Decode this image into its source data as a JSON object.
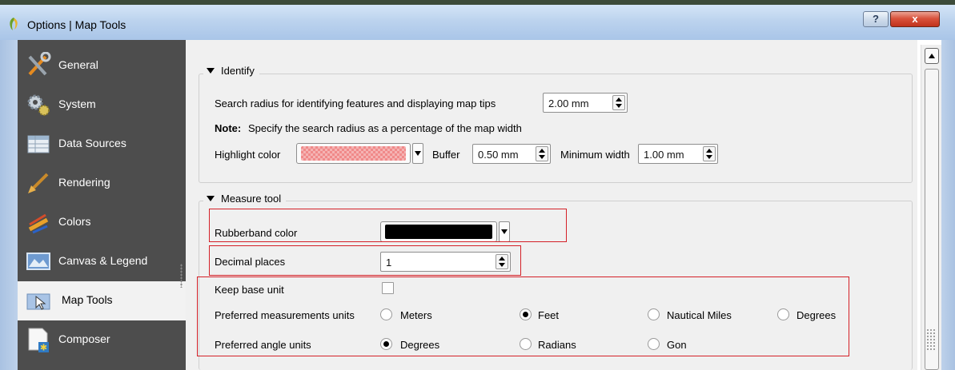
{
  "window": {
    "title": "Options | Map Tools",
    "help_label": "?",
    "close_label": "x"
  },
  "sidebar": {
    "items": [
      {
        "label": "General",
        "icon": "tools-icon"
      },
      {
        "label": "System",
        "icon": "gears-icon"
      },
      {
        "label": "Data Sources",
        "icon": "table-icon"
      },
      {
        "label": "Rendering",
        "icon": "paintbrush-icon"
      },
      {
        "label": "Colors",
        "icon": "color-brushes-icon"
      },
      {
        "label": "Canvas & Legend",
        "icon": "map-canvas-icon"
      },
      {
        "label": "Map Tools",
        "icon": "map-cursor-icon",
        "active": true
      },
      {
        "label": "Composer",
        "icon": "composer-page-icon"
      }
    ]
  },
  "identify": {
    "title": "Identify",
    "search_radius_label": "Search radius for identifying features and displaying map tips",
    "search_radius_value": "2.00 mm",
    "note_bold": "Note:",
    "note_text": "Specify the search radius as a percentage of the map width",
    "highlight_label": "Highlight color",
    "highlight_color": "#f08a8a",
    "buffer_label": "Buffer",
    "buffer_value": "0.50 mm",
    "min_width_label": "Minimum width",
    "min_width_value": "1.00 mm"
  },
  "measure": {
    "title": "Measure tool",
    "rubberband_label": "Rubberband color",
    "rubberband_color": "#000000",
    "decimal_label": "Decimal places",
    "decimal_value": "1",
    "keep_base_label": "Keep base unit",
    "keep_base_checked": false,
    "pref_meas_label": "Preferred measurements units",
    "meas_units": [
      {
        "label": "Meters",
        "selected": false
      },
      {
        "label": "Feet",
        "selected": true
      },
      {
        "label": "Nautical Miles",
        "selected": false
      },
      {
        "label": "Degrees",
        "selected": false
      }
    ],
    "pref_angle_label": "Preferred angle units",
    "angle_units": [
      {
        "label": "Degrees",
        "selected": true
      },
      {
        "label": "Radians",
        "selected": false
      },
      {
        "label": "Gon",
        "selected": false
      }
    ]
  },
  "colors": {
    "sidebar_bg": "#4d4d4d",
    "highlight_outline": "#d42027"
  }
}
